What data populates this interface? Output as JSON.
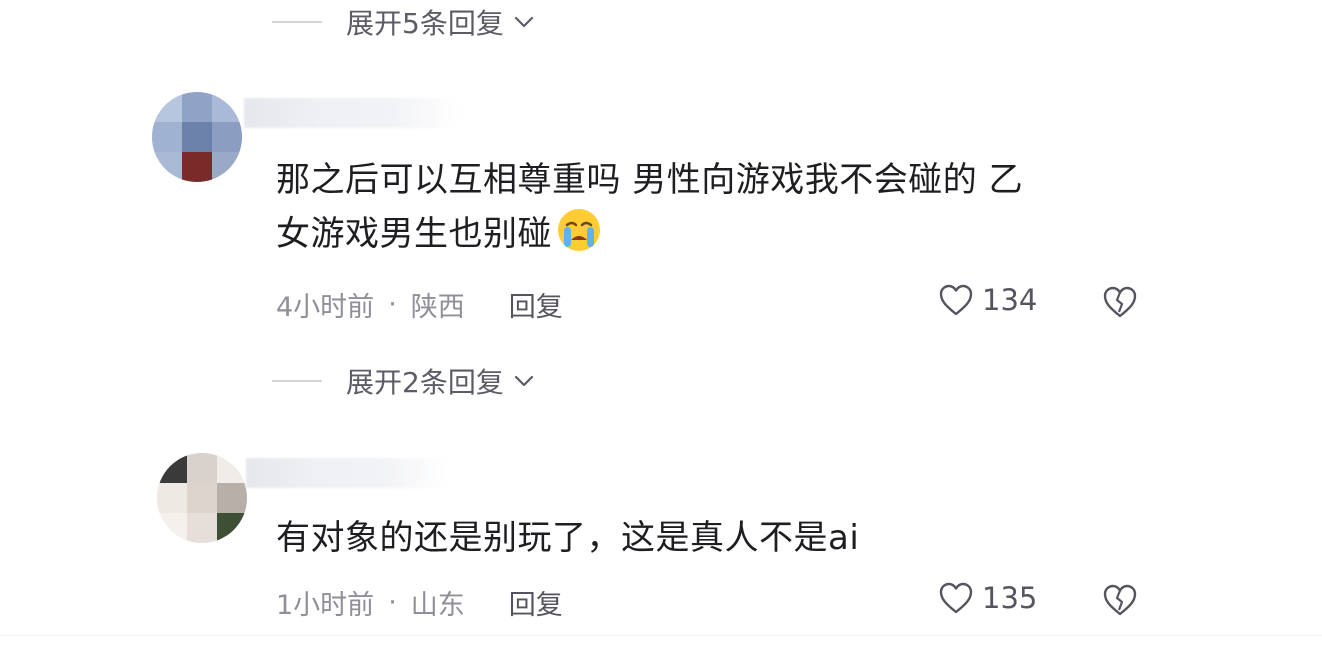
{
  "replies_top": {
    "label": "展开5条回复"
  },
  "comments": [
    {
      "text_line1": "那之后可以互相尊重吗 男性向游戏我不会碰的 乙",
      "text_line2": "女游戏男生也别碰",
      "emoji": "loudly-crying-face",
      "time": "4小时前",
      "location": "陕西",
      "reply_label": "回复",
      "likes": "134",
      "expand_label": "展开2条回复"
    },
    {
      "text_line1": "有对象的还是别玩了，这是真人不是ai",
      "time": "1小时前",
      "location": "山东",
      "reply_label": "回复",
      "likes": "135"
    }
  ],
  "separator": "·",
  "colors": {
    "text": "#1e1e22",
    "meta": "#8f8f99",
    "action": "#55555f",
    "rule": "#d4d4d8"
  }
}
